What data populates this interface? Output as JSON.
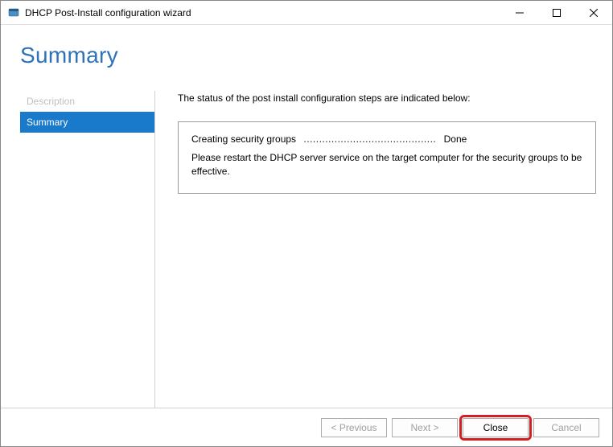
{
  "window": {
    "title": "DHCP Post-Install configuration wizard"
  },
  "page": {
    "heading": "Summary"
  },
  "sidebar": {
    "items": [
      {
        "label": "Description",
        "state": "disabled"
      },
      {
        "label": "Summary",
        "state": "active"
      }
    ]
  },
  "content": {
    "intro": "The status of the post install configuration steps are indicated below:",
    "status": {
      "label": "Creating security groups",
      "dots": "...........................................",
      "result": "Done"
    },
    "instruction": "Please restart the DHCP server service on the target computer for the security groups to be effective."
  },
  "footer": {
    "previous": "< Previous",
    "next": "Next >",
    "close": "Close",
    "cancel": "Cancel"
  }
}
